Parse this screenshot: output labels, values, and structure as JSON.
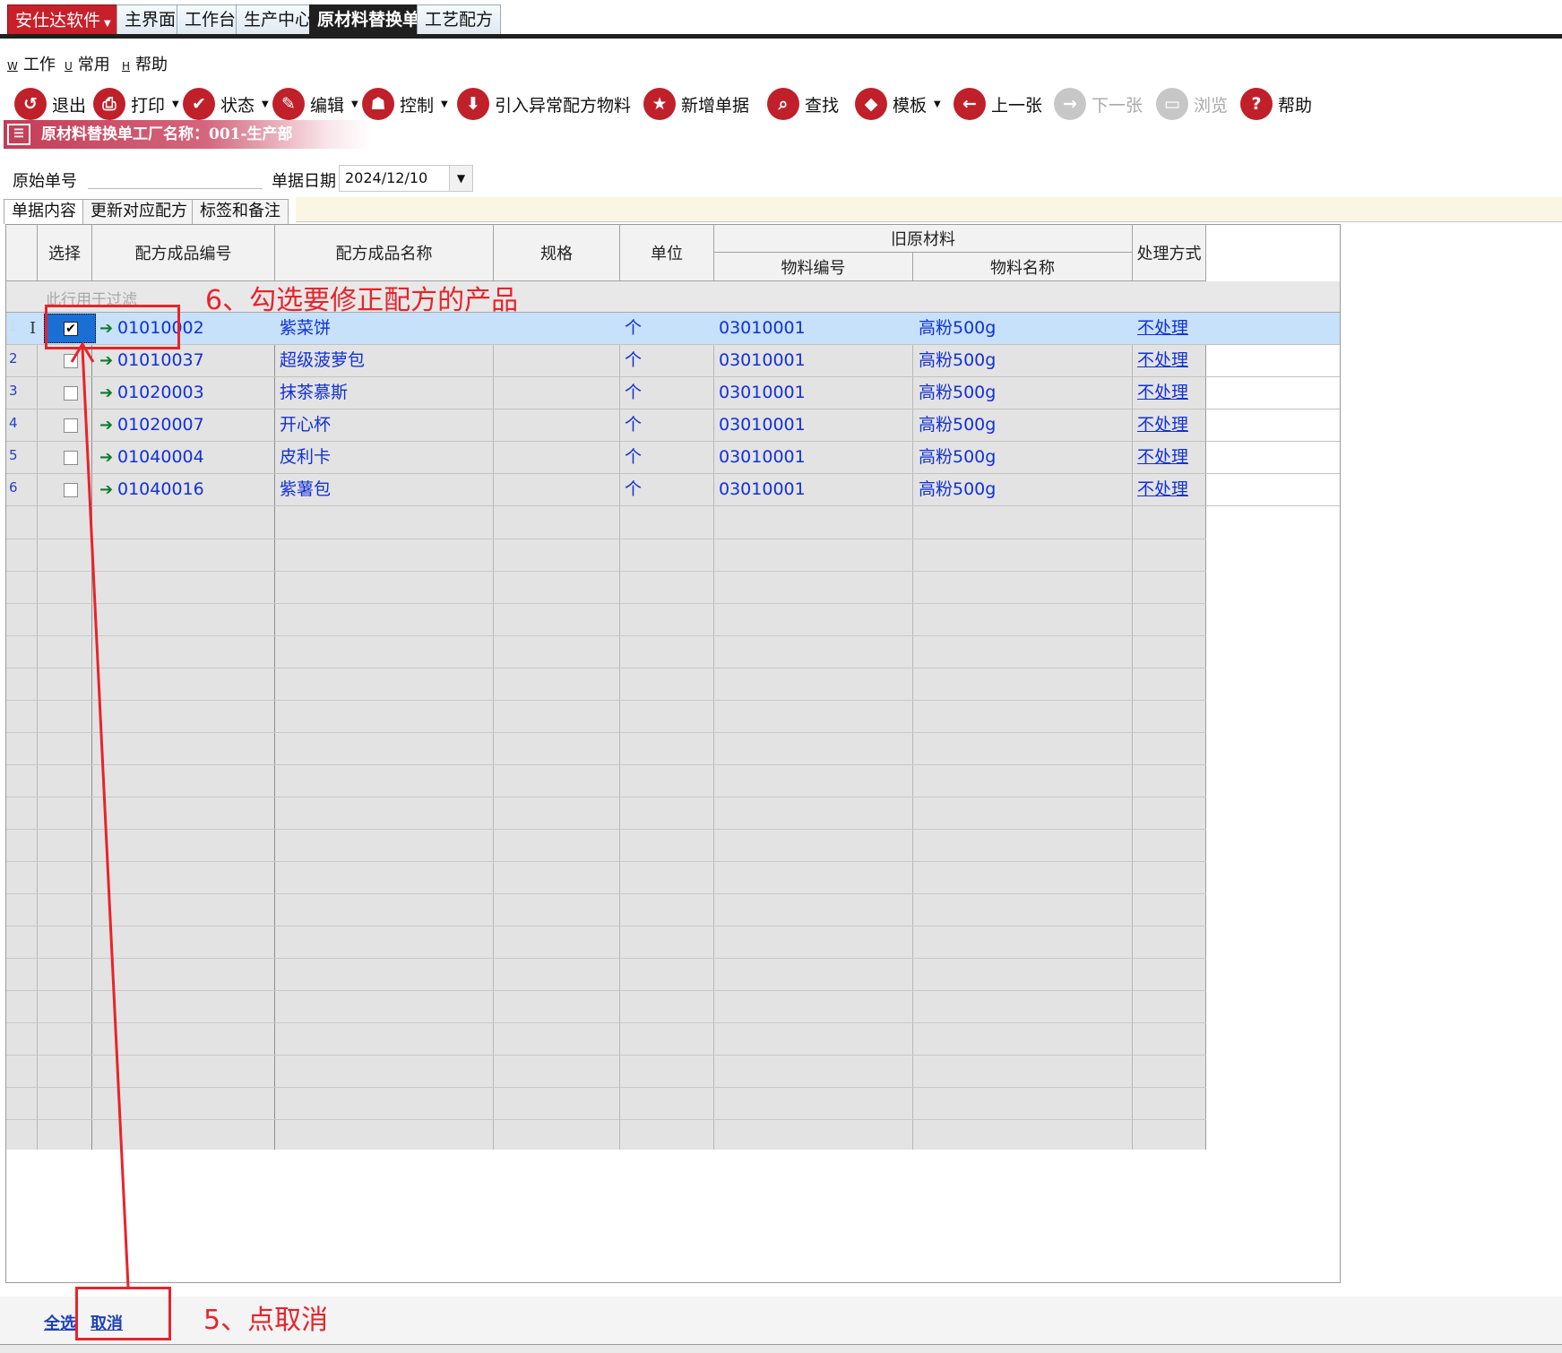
{
  "topbar": {
    "brand": "安仕达软件",
    "tabs": [
      "主界面",
      "工作台",
      "生产中心",
      "原材料替换单",
      "工艺配方"
    ],
    "active_tab": "原材料替换单"
  },
  "menubar": [
    {
      "accel": "W",
      "label": "工作"
    },
    {
      "accel": "U",
      "label": "常用"
    },
    {
      "accel": "H",
      "label": "帮助"
    }
  ],
  "toolbar": [
    {
      "label": "退出",
      "icon": "exit-icon",
      "dropdown": false,
      "disabled": false
    },
    {
      "label": "打印",
      "icon": "print-icon",
      "dropdown": true,
      "disabled": false
    },
    {
      "label": "状态",
      "icon": "check-icon",
      "dropdown": true,
      "disabled": false
    },
    {
      "label": "编辑",
      "icon": "edit-icon",
      "dropdown": true,
      "disabled": false
    },
    {
      "label": "控制",
      "icon": "user-icon",
      "dropdown": true,
      "disabled": false
    },
    {
      "label": "引入异常配方物料",
      "icon": "download-icon",
      "dropdown": false,
      "disabled": false
    },
    {
      "label": "新增单据",
      "icon": "star-icon",
      "dropdown": false,
      "disabled": false
    },
    {
      "label": "查找",
      "icon": "search-icon",
      "dropdown": false,
      "disabled": false
    },
    {
      "label": "模板",
      "icon": "eraser-icon",
      "dropdown": true,
      "disabled": false
    },
    {
      "label": "上一张",
      "icon": "arrow-left-icon",
      "dropdown": false,
      "disabled": false
    },
    {
      "label": "下一张",
      "icon": "arrow-right-icon",
      "dropdown": false,
      "disabled": true
    },
    {
      "label": "浏览",
      "icon": "folder-icon",
      "dropdown": false,
      "disabled": true
    },
    {
      "label": "帮助",
      "icon": "help-icon",
      "dropdown": false,
      "disabled": false
    }
  ],
  "form": {
    "title": "原材料替换单工厂名称：001-生产部",
    "original_no_label": "原始单号",
    "original_no_value": "",
    "date_label": "单据日期",
    "date_value": "2024/12/10"
  },
  "subtabs": [
    "单据内容",
    "更新对应配方",
    "标签和备注"
  ],
  "grid": {
    "headers": {
      "select": "选择",
      "product_code": "配方成品编号",
      "product_name": "配方成品名称",
      "spec": "规格",
      "unit": "单位",
      "old_material": "旧原材料",
      "material_code": "物料编号",
      "material_name": "物料名称",
      "handling": "处理方式"
    },
    "filter_placeholder": "此行用于过滤",
    "rows": [
      {
        "num": "1",
        "checked": true,
        "product_code": "01010002",
        "product_name": "紫菜饼",
        "spec": "",
        "unit": "个",
        "material_code": "03010001",
        "material_name": "高粉500g",
        "handling": "不处理"
      },
      {
        "num": "2",
        "checked": false,
        "product_code": "01010037",
        "product_name": "超级菠萝包",
        "spec": "",
        "unit": "个",
        "material_code": "03010001",
        "material_name": "高粉500g",
        "handling": "不处理"
      },
      {
        "num": "3",
        "checked": false,
        "product_code": "01020003",
        "product_name": "抹茶慕斯",
        "spec": "",
        "unit": "个",
        "material_code": "03010001",
        "material_name": "高粉500g",
        "handling": "不处理"
      },
      {
        "num": "4",
        "checked": false,
        "product_code": "01020007",
        "product_name": "开心杯",
        "spec": "",
        "unit": "个",
        "material_code": "03010001",
        "material_name": "高粉500g",
        "handling": "不处理"
      },
      {
        "num": "5",
        "checked": false,
        "product_code": "01040004",
        "product_name": "皮利卡",
        "spec": "",
        "unit": "个",
        "material_code": "03010001",
        "material_name": "高粉500g",
        "handling": "不处理"
      },
      {
        "num": "6",
        "checked": false,
        "product_code": "01040016",
        "product_name": "紫薯包",
        "spec": "",
        "unit": "个",
        "material_code": "03010001",
        "material_name": "高粉500g",
        "handling": "不处理"
      }
    ]
  },
  "bottom": {
    "select_all": "全选",
    "cancel": "取消"
  },
  "annotations": {
    "step6": "6、勾选要修正配方的产品",
    "step5": "5、点取消"
  },
  "colors": {
    "accent_red": "#c0202a",
    "link_blue": "#1230d8",
    "selected_row": "#c6e1f9",
    "annotation_red": "#e8232a"
  }
}
